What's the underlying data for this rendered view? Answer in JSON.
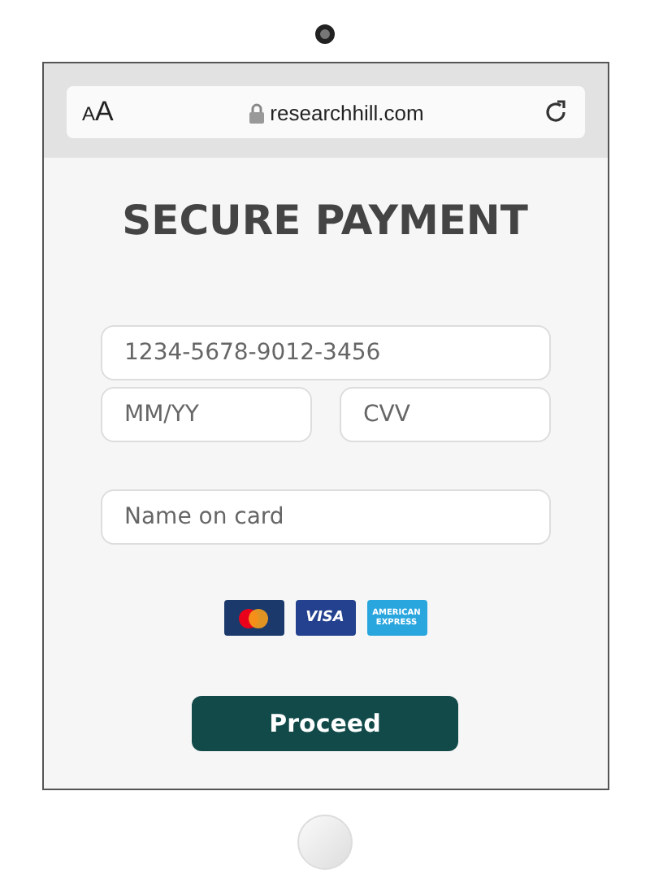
{
  "browser": {
    "text_size_label": "AA",
    "url": "researchhill.com"
  },
  "title": "SECURE PAYMENT",
  "fields": [
    {
      "placeholder": "1234-5678-9012-3456"
    },
    {
      "placeholder": "MM/YY"
    },
    {
      "placeholder": "CVV"
    },
    {
      "placeholder": "Name on card"
    }
  ],
  "cards": [
    {
      "kind": "mastercard"
    },
    {
      "kind": "visa",
      "label": "VISA"
    },
    {
      "kind": "amex",
      "label": "AMERICAN EXPRESS"
    }
  ],
  "button": "Proceed"
}
